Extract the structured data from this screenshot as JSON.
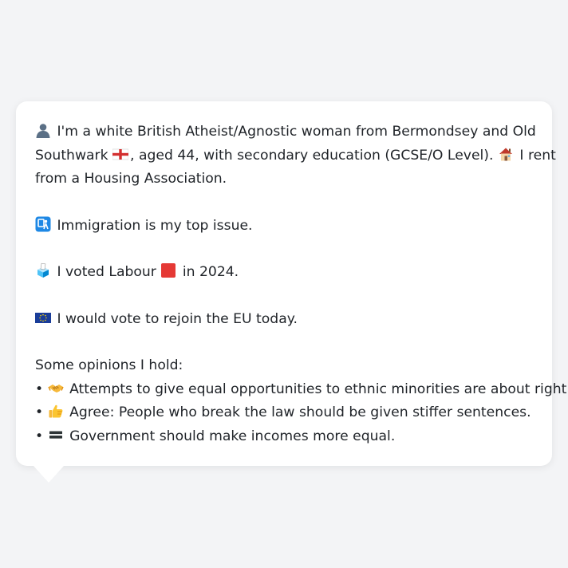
{
  "bio": {
    "person_icon": "bust-in-silhouette-icon",
    "intro": "I'm a white British Atheist/Agnostic woman from Bermondsey and Old",
    "intro_cont": "Southwark",
    "flag_icon": "england-flag-icon",
    "intro_cont2": ", aged 44, with secondary education (GCSE/O Level).",
    "house_icon": "house-icon",
    "housing_start": "I rent",
    "housing_end": "from a Housing Association."
  },
  "issue": {
    "icon": "passport-control-icon",
    "text": "Immigration is my top issue."
  },
  "vote": {
    "icon": "ballot-box-icon",
    "before": "I voted Labour",
    "party_icon": "red-square-icon",
    "party_color": "#e53935",
    "after": "in 2024."
  },
  "eu": {
    "icon": "eu-flag-icon",
    "text": "I would vote to rejoin the EU today."
  },
  "opinions": {
    "heading": "Some opinions I hold:",
    "bullet": "•",
    "items": [
      {
        "icon": "handshake-icon",
        "text": "Attempts to give equal opportunities to ethnic minorities are about right."
      },
      {
        "icon": "thumbs-up-icon",
        "text": "Agree: People who break the law should be given stiffer sentences."
      },
      {
        "icon": "equals-sign-icon",
        "text": "Government should make incomes more equal."
      }
    ]
  }
}
